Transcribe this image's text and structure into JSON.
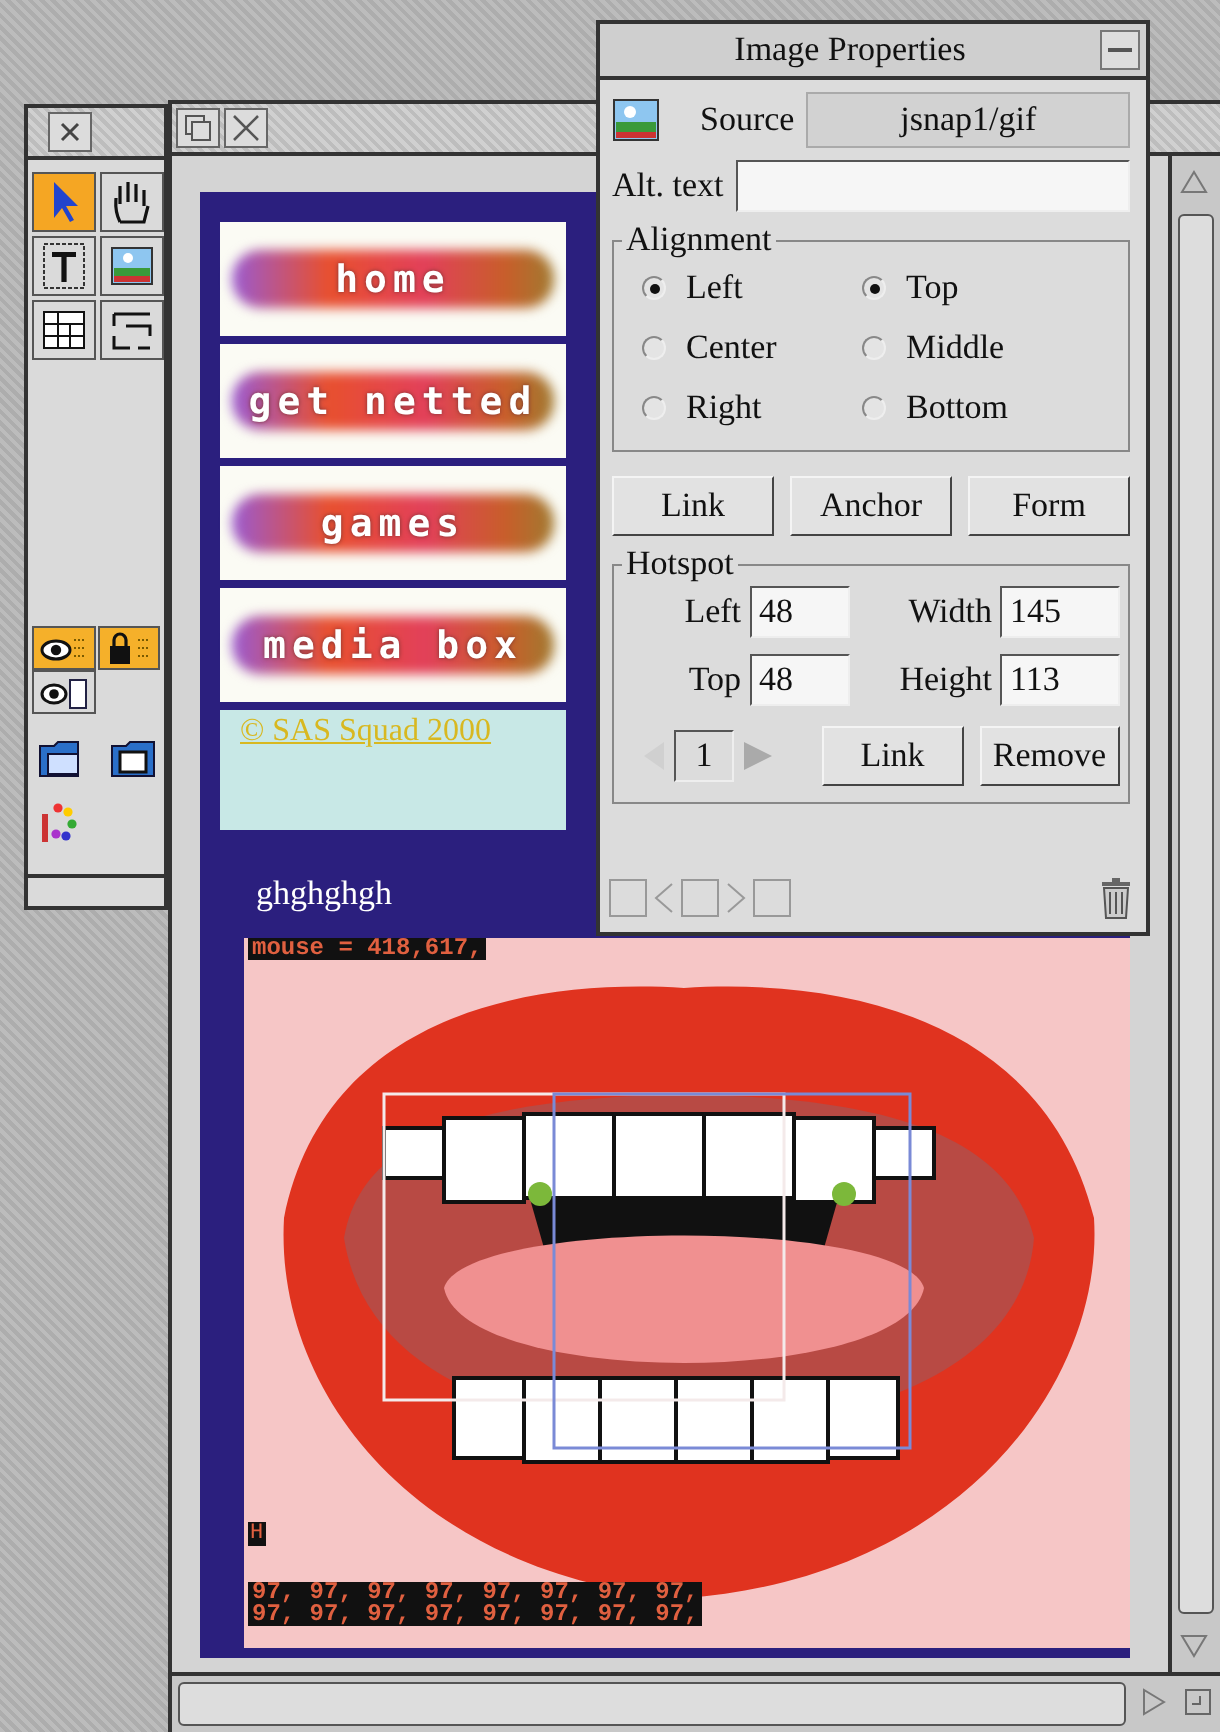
{
  "toolbox": {
    "tools": [
      {
        "kind": "pointer",
        "selected": true
      },
      {
        "kind": "hand",
        "selected": false
      },
      {
        "kind": "text",
        "selected": false
      },
      {
        "kind": "picture",
        "selected": false
      },
      {
        "kind": "table",
        "selected": false
      },
      {
        "kind": "form",
        "selected": false
      }
    ],
    "toggles": [
      {
        "kind": "view",
        "on": true
      },
      {
        "kind": "lock",
        "on": true
      },
      {
        "kind": "preview",
        "on": false
      }
    ],
    "actions": [
      {
        "kind": "folder"
      },
      {
        "kind": "window"
      },
      {
        "kind": "palette"
      }
    ]
  },
  "page": {
    "nav_buttons": [
      {
        "label": "home"
      },
      {
        "label": "get netted"
      },
      {
        "label": "games"
      },
      {
        "label": "media box"
      }
    ],
    "copyright": "© SAS Squad 2000",
    "caption": "ghghghgh",
    "image": {
      "debug_top": "mouse = 418,617,",
      "marker": "H",
      "debug_bottom": [
        "97, 97, 97, 97, 97, 97, 97, 97,",
        "97, 97, 97, 97, 97, 97, 97, 97,"
      ]
    }
  },
  "dialog": {
    "title": "Image Properties",
    "source": {
      "label": "Source",
      "value": "jsnap1/gif"
    },
    "alt_text": {
      "label": "Alt. text"
    },
    "alignment": {
      "title": "Alignment",
      "horizontal": [
        {
          "label": "Left",
          "selected": true
        },
        {
          "label": "Center",
          "selected": false
        },
        {
          "label": "Right",
          "selected": false
        }
      ],
      "vertical": [
        {
          "label": "Top",
          "selected": true
        },
        {
          "label": "Middle",
          "selected": false
        },
        {
          "label": "Bottom",
          "selected": false
        }
      ]
    },
    "buttons": [
      "Link",
      "Anchor",
      "Form"
    ],
    "hotspot": {
      "title": "Hotspot",
      "fields": [
        {
          "label": "Left",
          "value": "48"
        },
        {
          "label": "Width",
          "value": "145"
        },
        {
          "label": "Top",
          "value": "48"
        },
        {
          "label": "Height",
          "value": "113"
        }
      ],
      "index": "1",
      "prev": {
        "disabled": true
      },
      "next": {
        "disabled": false
      },
      "buttons": [
        "Link",
        "Remove"
      ]
    }
  }
}
